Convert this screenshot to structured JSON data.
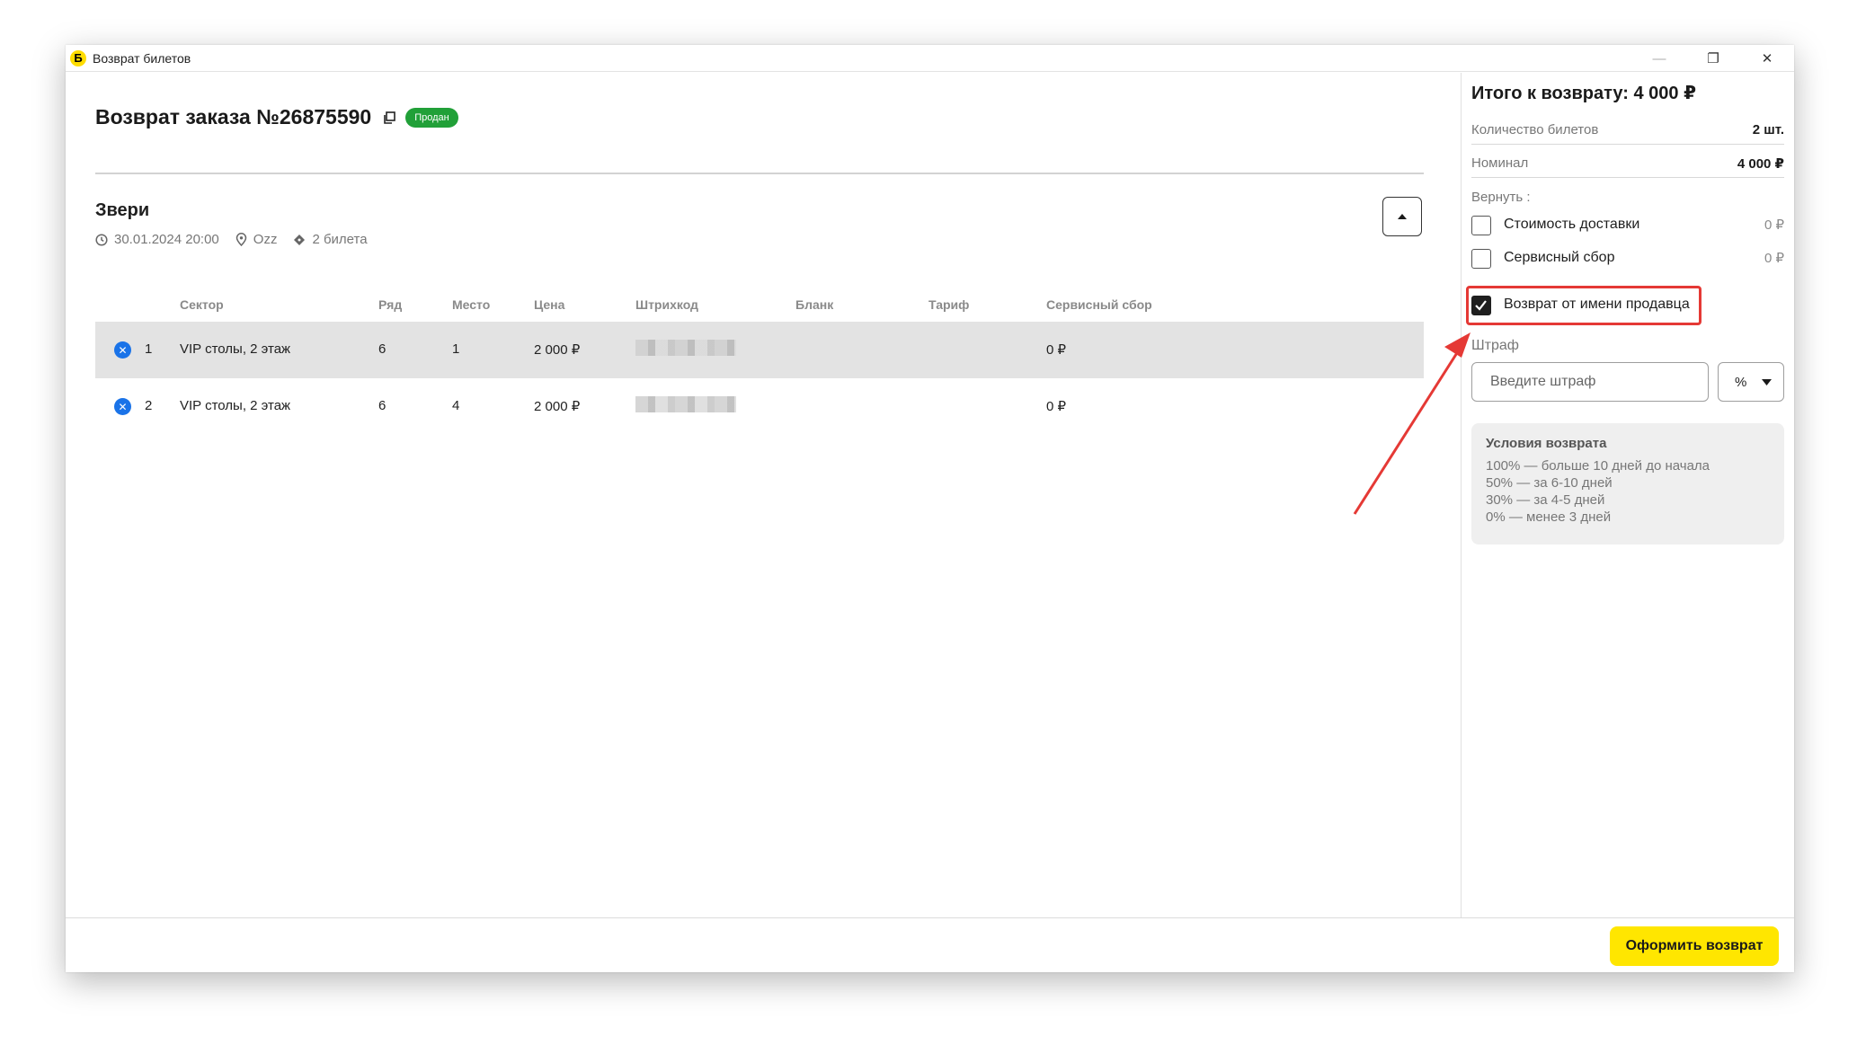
{
  "window": {
    "title": "Возврат билетов",
    "controls": {
      "minimize": "—",
      "restore": "❐",
      "close": "✕"
    }
  },
  "order": {
    "title": "Возврат заказа №26875590",
    "status": "Продан"
  },
  "event": {
    "name": "Звери",
    "datetime": "30.01.2024 20:00",
    "venue": "Ozz",
    "tickets_count": "2 билета"
  },
  "table": {
    "headers": {
      "sector": "Сектор",
      "row": "Ряд",
      "seat": "Место",
      "price": "Цена",
      "barcode": "Штрихкод",
      "blank": "Бланк",
      "tariff": "Тариф",
      "service_fee": "Сервисный сбор"
    },
    "rows": [
      {
        "num": "1",
        "sector": "VIP столы, 2 этаж",
        "row": "6",
        "seat": "1",
        "price": "2 000 ₽",
        "service_fee": "0 ₽"
      },
      {
        "num": "2",
        "sector": "VIP столы, 2 этаж",
        "row": "6",
        "seat": "4",
        "price": "2 000 ₽",
        "service_fee": "0 ₽"
      }
    ]
  },
  "summary": {
    "total": "Итого к возврату: 4 000 ₽",
    "ticket_count_label": "Количество билетов",
    "ticket_count_value": "2 шт.",
    "nominal_label": "Номинал",
    "nominal_value": "4 000 ₽",
    "return_label": "Вернуть :",
    "delivery_label": "Стоимость доставки",
    "delivery_value": "0 ₽",
    "service_fee_label": "Сервисный сбор",
    "service_fee_value": "0 ₽",
    "seller_return_label": "Возврат от имени продавца",
    "seller_return_checked": true,
    "fine_label": "Штраф",
    "fine_placeholder": "Введите штраф",
    "fine_unit": "%"
  },
  "conditions": {
    "title": "Условия возврата",
    "lines": [
      "100% — больше 10 дней до начала",
      "50% — за 6-10 дней",
      "30% — за 4-5 дней",
      "0% — менее 3 дней"
    ]
  },
  "actions": {
    "submit": "Оформить возврат"
  },
  "colors": {
    "status_green": "#21a038",
    "accent_yellow": "#ffe600",
    "remove_blue": "#1a73e8",
    "annotation_red": "#e53935"
  }
}
